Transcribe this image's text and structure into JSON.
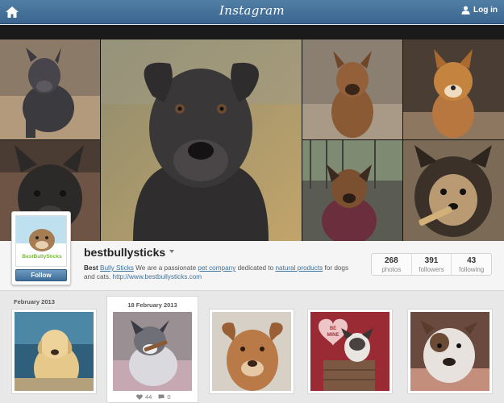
{
  "nav": {
    "brand": "Instagram",
    "login_label": "Log in"
  },
  "profile": {
    "username": "bestbullysticks",
    "follow_label": "Follow",
    "avatar_text": "BestBullySticks",
    "bio": {
      "name": "Best",
      "name_link": "Bully Sticks",
      "text1": "We are a passionate",
      "link1": "pet company",
      "text2": "dedicated to",
      "link2": "natural products",
      "text3": "for dogs and cats.",
      "url": "http://www.bestbullysticks.com"
    },
    "stats": [
      {
        "count": "268",
        "label": "photos"
      },
      {
        "count": "391",
        "label": "followers"
      },
      {
        "count": "43",
        "label": "following"
      }
    ]
  },
  "feed": {
    "month_label": "February 2013",
    "selected_date": "18 February 2013",
    "likes": "44",
    "comments": "0"
  },
  "colors": {
    "nav_blue": "#3f729b",
    "link_blue": "#3f729b"
  }
}
